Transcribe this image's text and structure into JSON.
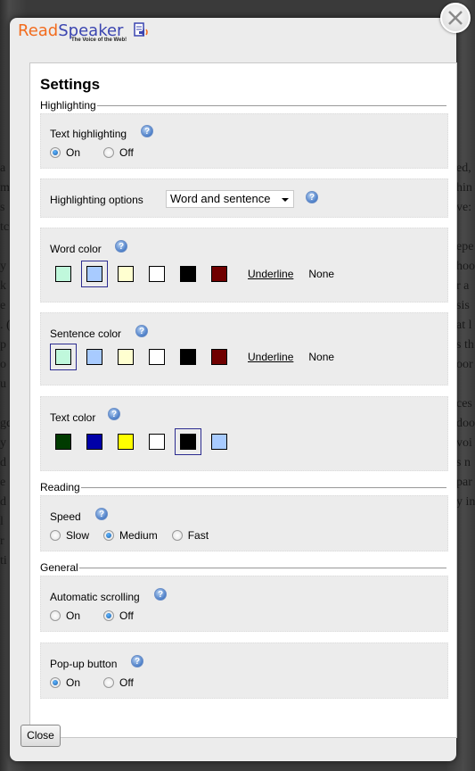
{
  "logo": {
    "read": "Read",
    "speaker": "Speaker",
    "tagline": "The Voice of the Web!"
  },
  "title": "Settings",
  "sections": {
    "highlighting": {
      "label": "Highlighting",
      "text_highlighting": {
        "label": "Text highlighting",
        "options": [
          "On",
          "Off"
        ],
        "selected": "On"
      },
      "highlighting_options": {
        "label": "Highlighting options",
        "value": "Word and sentence"
      },
      "word_color": {
        "label": "Word color",
        "swatches": [
          "#c0f8dc",
          "#a8cbff",
          "#ffffd0",
          "#ffffff",
          "#000000",
          "#700000"
        ],
        "selected_index": 1,
        "underline_label": "Underline",
        "none_label": "None"
      },
      "sentence_color": {
        "label": "Sentence color",
        "swatches": [
          "#c0f8dc",
          "#a8cbff",
          "#ffffd0",
          "#ffffff",
          "#000000",
          "#700000"
        ],
        "selected_index": 0,
        "underline_label": "Underline",
        "none_label": "None"
      },
      "text_color": {
        "label": "Text color",
        "swatches": [
          "#003b00",
          "#0000a8",
          "#ffff00",
          "#ffffff",
          "#000000",
          "#a8cbff"
        ],
        "selected_index": 4
      }
    },
    "reading": {
      "label": "Reading",
      "speed": {
        "label": "Speed",
        "options": [
          "Slow",
          "Medium",
          "Fast"
        ],
        "selected": "Medium"
      }
    },
    "general": {
      "label": "General",
      "automatic_scrolling": {
        "label": "Automatic scrolling",
        "options": [
          "On",
          "Off"
        ],
        "selected": "Off"
      },
      "popup_button": {
        "label": "Pop-up button",
        "options": [
          "On",
          "Off"
        ],
        "selected": "On"
      }
    }
  },
  "buttons": {
    "close": "Close"
  },
  "help_glyph": "?",
  "background_text": {
    "left": [
      "a",
      "m",
      "s",
      "tc",
      "",
      "y",
      "k",
      "e",
      ". (",
      "p",
      "o",
      "u",
      "",
      "gc",
      "y",
      "d",
      "e",
      "d",
      "l",
      "r",
      "ti"
    ],
    "right": [
      "ed,",
      "hin",
      "ve:",
      "",
      "epe",
      "hoo",
      "r a",
      "sis",
      "at l",
      "s th",
      "oor",
      "",
      "ces",
      "doo",
      "voi",
      "s n",
      "par",
      "y in"
    ]
  }
}
